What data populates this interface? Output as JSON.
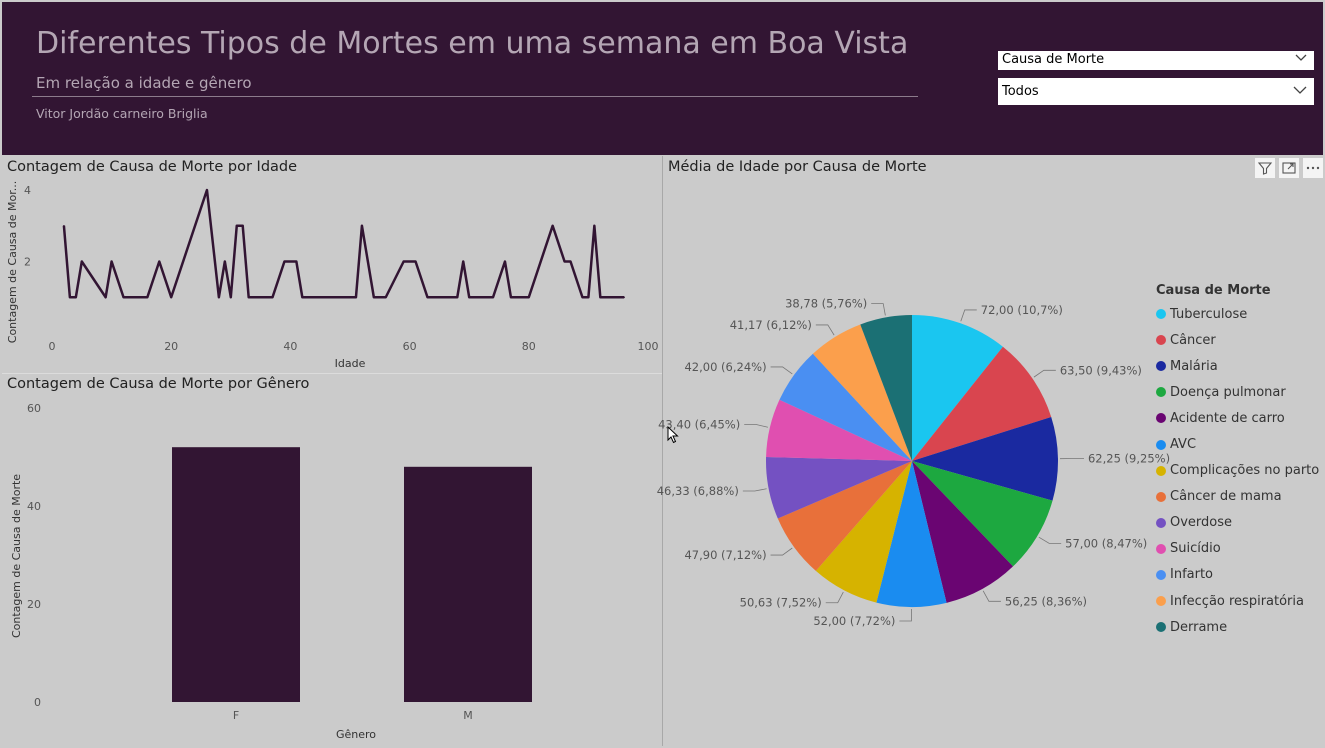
{
  "header": {
    "title": "Diferentes Tipos de Mortes em uma semana em Boa Vista",
    "subtitle": "Em relação a idade e gênero",
    "author": "Vitor Jordão carneiro Briglia"
  },
  "slicers": {
    "field": "Causa de Morte",
    "value": "Todos"
  },
  "line_panel": {
    "title": "Contagem de Causa de Morte por Idade"
  },
  "bar_panel": {
    "title": "Contagem de Causa de Morte por Gênero"
  },
  "pie_panel": {
    "title": "Média de Idade por Causa de Morte"
  },
  "colors": {
    "header_bg": "#321533",
    "mark": "#321533",
    "canvas": "#cbcbcb"
  },
  "chart_data": [
    {
      "type": "line",
      "title": "Contagem de Causa de Morte por Idade",
      "xlabel": "Idade",
      "ylabel": "Contagem de Causa de Mor...",
      "xlim": [
        0,
        100
      ],
      "ylim": [
        0,
        4
      ],
      "x_ticks": [
        "0",
        "20",
        "40",
        "60",
        "80",
        "100"
      ],
      "y_ticks": [
        "2",
        "4"
      ],
      "x": [
        2,
        3,
        4,
        5,
        9,
        10,
        12,
        16,
        18,
        20,
        26,
        28,
        29,
        30,
        31,
        32,
        33,
        36,
        37,
        39,
        41,
        42,
        50,
        51,
        52,
        53,
        54,
        56,
        59,
        61,
        63,
        68,
        69,
        70,
        74,
        76,
        77,
        80,
        82,
        84,
        86,
        87,
        89,
        90,
        91,
        92,
        93,
        94,
        96
      ],
      "values": [
        3,
        1,
        1,
        2,
        1,
        2,
        1,
        1,
        2,
        1,
        4,
        1,
        2,
        1,
        3,
        3,
        1,
        1,
        1,
        2,
        2,
        1,
        1,
        1,
        3,
        2,
        1,
        1,
        2,
        2,
        1,
        1,
        2,
        1,
        1,
        2,
        1,
        1,
        2,
        3,
        2,
        2,
        1,
        1,
        3,
        1,
        1,
        1,
        1
      ]
    },
    {
      "type": "bar",
      "title": "Contagem de Causa de Morte por Gênero",
      "xlabel": "Gênero",
      "ylabel": "Contagem de Causa de Morte",
      "categories": [
        "F",
        "M"
      ],
      "values": [
        52,
        48
      ],
      "ylim": [
        0,
        60
      ],
      "y_ticks": [
        "0",
        "20",
        "40",
        "60"
      ]
    },
    {
      "type": "pie",
      "title": "Média de Idade por Causa de Morte",
      "legend_title": "Causa de Morte",
      "legend": "right",
      "slices": [
        {
          "label": "Tuberculose",
          "value": 72.0,
          "data_label": "72,00 (10,7%)",
          "color": "#1ac6f0"
        },
        {
          "label": "Câncer",
          "value": 63.5,
          "data_label": "63,50 (9,43%)",
          "color": "#d9454f"
        },
        {
          "label": "Malária",
          "value": 62.25,
          "data_label": "62,25 (9,25%)",
          "color": "#1a29a0"
        },
        {
          "label": "Doença pulmonar",
          "value": 57.0,
          "data_label": "57,00 (8,47%)",
          "color": "#1da840"
        },
        {
          "label": "Acidente de carro",
          "value": 56.25,
          "data_label": "56,25 (8,36%)",
          "color": "#6a0572"
        },
        {
          "label": "AVC",
          "value": 52.0,
          "data_label": "52,00 (7,72%)",
          "color": "#1a8cf0"
        },
        {
          "label": "Complicações no parto",
          "value": 50.63,
          "data_label": "50,63 (7,52%)",
          "color": "#d6b300"
        },
        {
          "label": "Câncer de mama",
          "value": 47.9,
          "data_label": "47,90 (7,12%)",
          "color": "#e8703a"
        },
        {
          "label": "Overdose",
          "value": 46.33,
          "data_label": "46,33 (6,88%)",
          "color": "#7451c2"
        },
        {
          "label": "Suicídio",
          "value": 43.4,
          "data_label": "43,40 (6,45%)",
          "color": "#e04fb0"
        },
        {
          "label": "Infarto",
          "value": 42.0,
          "data_label": "42,00 (6,24%)",
          "color": "#4a8ff2"
        },
        {
          "label": "Infecção respiratória",
          "value": 41.17,
          "data_label": "41,17 (6,12%)",
          "color": "#fb9f4c"
        },
        {
          "label": "Derrame",
          "value": 38.78,
          "data_label": "38,78 (5,76%)",
          "color": "#1b7074"
        }
      ]
    }
  ]
}
